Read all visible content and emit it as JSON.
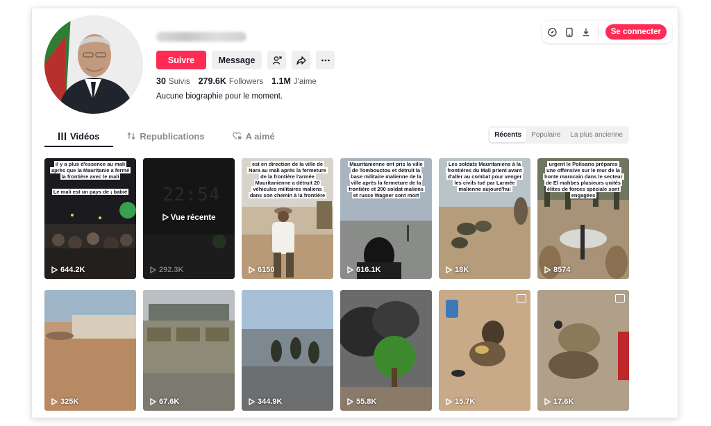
{
  "header": {
    "login_label": "Se connecter",
    "icons": [
      "compass-icon",
      "mobile-icon",
      "download-icon"
    ]
  },
  "profile": {
    "follow_label": "Suivre",
    "message_label": "Message",
    "stats": {
      "following_count": "30",
      "following_label": "Suivis",
      "followers_count": "279.6K",
      "followers_label": "Followers",
      "likes_count": "1.1M",
      "likes_label": "J'aime"
    },
    "bio": "Aucune biographie pour le moment."
  },
  "tabs": [
    {
      "label": "Vidéos",
      "icon": "grid-icon",
      "active": true
    },
    {
      "label": "Republications",
      "icon": "repost-icon",
      "active": false
    },
    {
      "label": "A aimé",
      "icon": "heart-lock-icon",
      "active": false
    }
  ],
  "sort": [
    {
      "label": "Récents",
      "active": true
    },
    {
      "label": "Populaire",
      "active": false
    },
    {
      "label": "La plus ancienne",
      "active": false
    }
  ],
  "videos": [
    {
      "views": "644.2K",
      "caption_top": "il y a plus d'essence au mali après que la Mauritanie a fermé la frontière avec le mali",
      "caption_mid": "Le mali est un pays de ¡ babié"
    },
    {
      "views": "292.3K",
      "clock": "22:54",
      "overlay": "Vue récente"
    },
    {
      "views": "6150",
      "caption_top": "est en direction de la ville de Nara au mali après la fermeture de la frontière l'armée Mauritanienne a détruit 20 véhicules militaires maliens dans son chemin à la frontière"
    },
    {
      "views": "616.1K",
      "caption_top": "Mauritanienne ont pris la ville de Tombouctou et détruit la base militaire malienne de la ville après la fermeture de la frontière et 200 soldat maliens et russe Wagner sont mort"
    },
    {
      "views": "18K",
      "caption_top": "Les soldats Mauritaniens à la frontières du Mali prient avant d'aller au combat pour venger les civils tué par Larmée malienne aujourd'hui"
    },
    {
      "views": "8574",
      "caption_top": "urgent le Polisario prépares une offensive sur le mur de la honte marocain dans le secteur de El mahbes plusieurs unités élites de forces spéciale sont engagées"
    },
    {
      "views": "325K"
    },
    {
      "views": "67.6K"
    },
    {
      "views": "344.9K"
    },
    {
      "views": "55.8K"
    },
    {
      "views": "15.7K"
    },
    {
      "views": "17.6K"
    }
  ]
}
